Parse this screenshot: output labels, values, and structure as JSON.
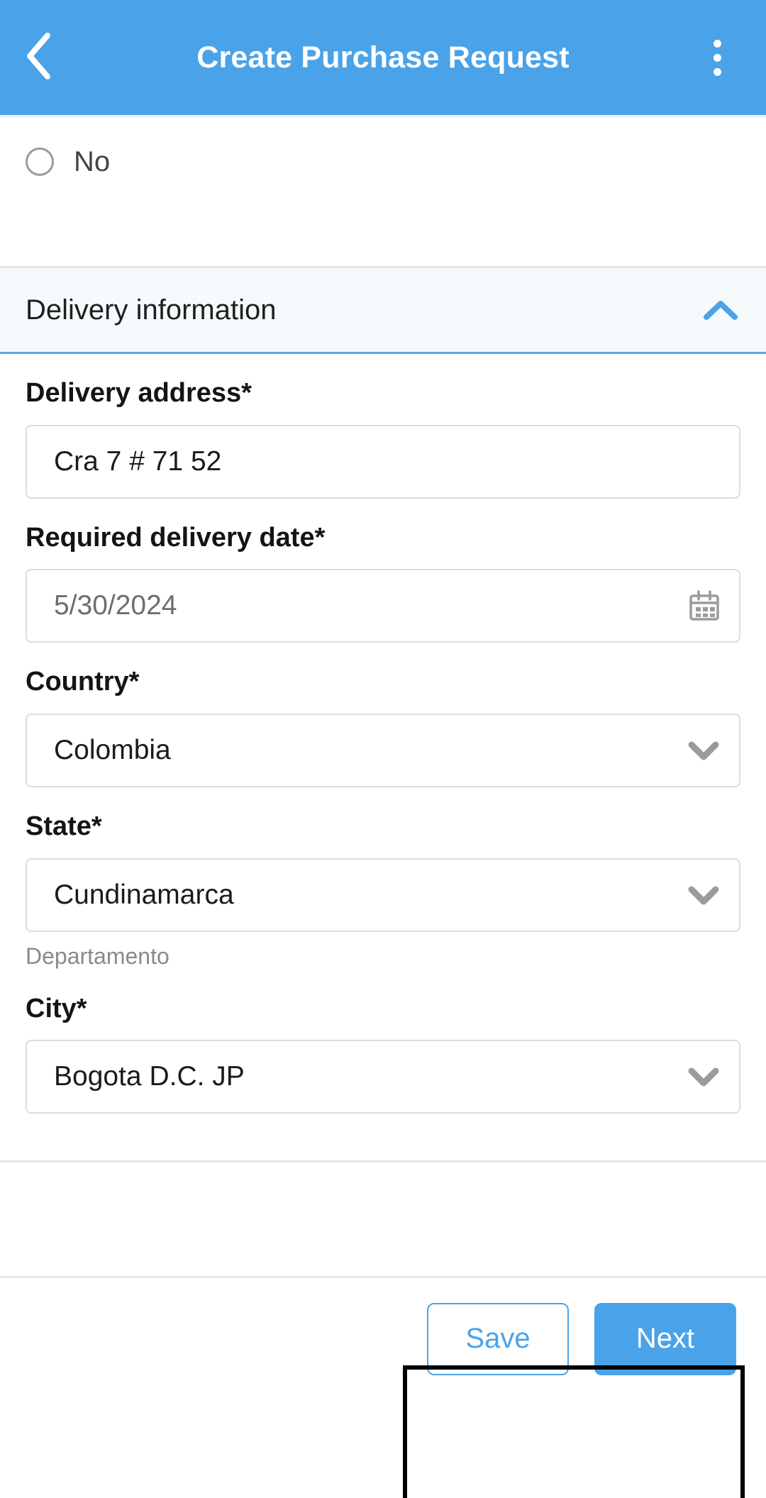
{
  "appbar": {
    "title": "Create Purchase Request",
    "back_icon": "chevron-left-icon",
    "menu_icon": "kebab-menu-icon",
    "background_color": "#4aa3e8"
  },
  "radio_option": {
    "label": "No",
    "selected": false
  },
  "section": {
    "title": "Delivery information",
    "expanded": true,
    "collapse_icon": "chevron-up-icon",
    "accent_color": "#5aa9e6"
  },
  "fields": [
    {
      "label": "Delivery address*",
      "value": "Cra 7 # 71 52",
      "type": "text",
      "muted": false,
      "addon_icon": "",
      "helper": ""
    },
    {
      "label": "Required delivery date*",
      "value": "5/30/2024",
      "type": "date",
      "muted": true,
      "addon_icon": "calendar-icon",
      "helper": ""
    },
    {
      "label": "Country*",
      "value": "Colombia",
      "type": "select",
      "muted": false,
      "addon_icon": "chevron-down-icon",
      "helper": ""
    },
    {
      "label": "State*",
      "value": "Cundinamarca",
      "type": "select",
      "muted": false,
      "addon_icon": "chevron-down-icon",
      "helper": "Departamento"
    },
    {
      "label": "City*",
      "value": "Bogota D.C. JP",
      "type": "select",
      "muted": false,
      "addon_icon": "chevron-down-icon",
      "helper": ""
    }
  ],
  "footer": {
    "save_label": "Save",
    "next_label": "Next"
  },
  "annotation": {
    "shape": "highlight-rectangle",
    "color": "#000000"
  }
}
